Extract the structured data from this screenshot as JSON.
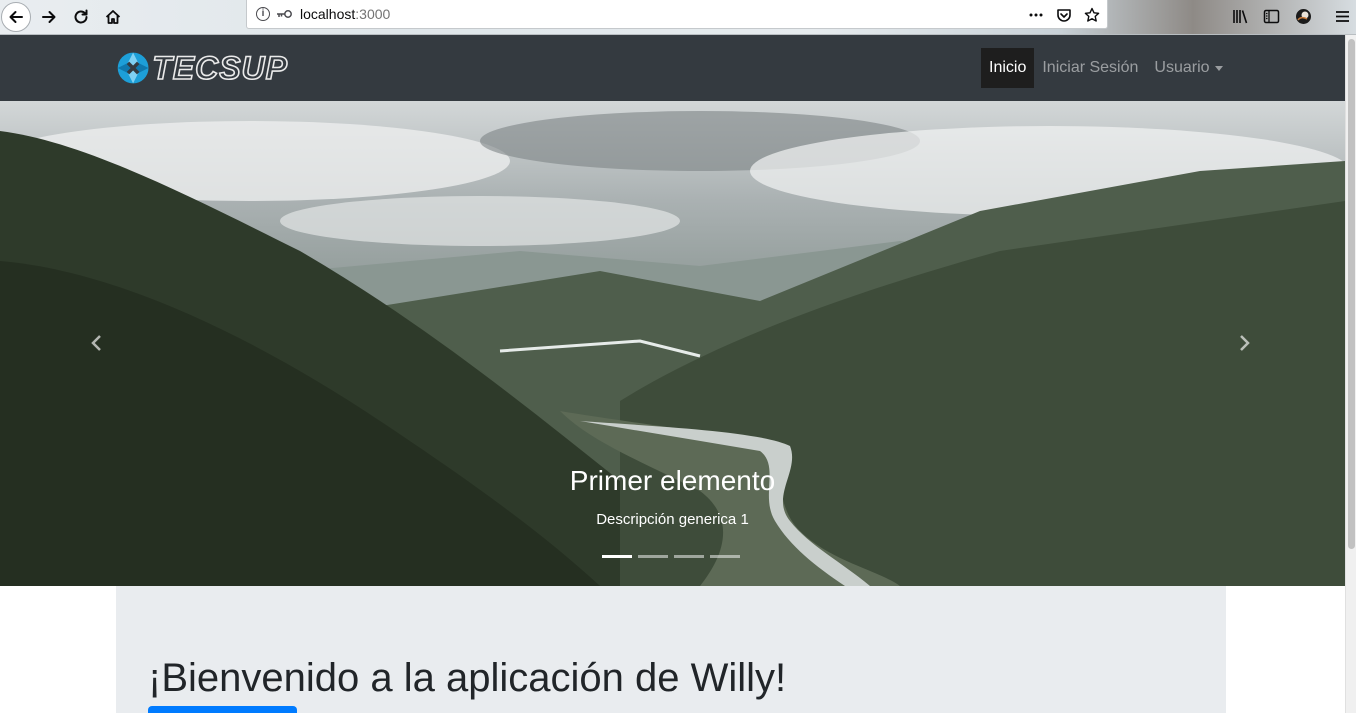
{
  "browser": {
    "url_host": "localhost",
    "url_port": ":3000"
  },
  "navbar": {
    "brand": "TECSUP",
    "items": [
      {
        "label": "Inicio",
        "active": true
      },
      {
        "label": "Iniciar Sesión",
        "active": false
      },
      {
        "label": "Usuario",
        "active": false,
        "dropdown": true
      }
    ]
  },
  "carousel": {
    "caption_title": "Primer elemento",
    "caption_description": "Descripción generica 1",
    "indicator_count": 4,
    "active_indicator": 1
  },
  "jumbotron": {
    "title": "¡Bienvenido a la aplicación de Willy!"
  },
  "colors": {
    "navbar_bg": "#343a40",
    "jumbotron_bg": "#e9ecef",
    "primary_button": "#007bff"
  }
}
